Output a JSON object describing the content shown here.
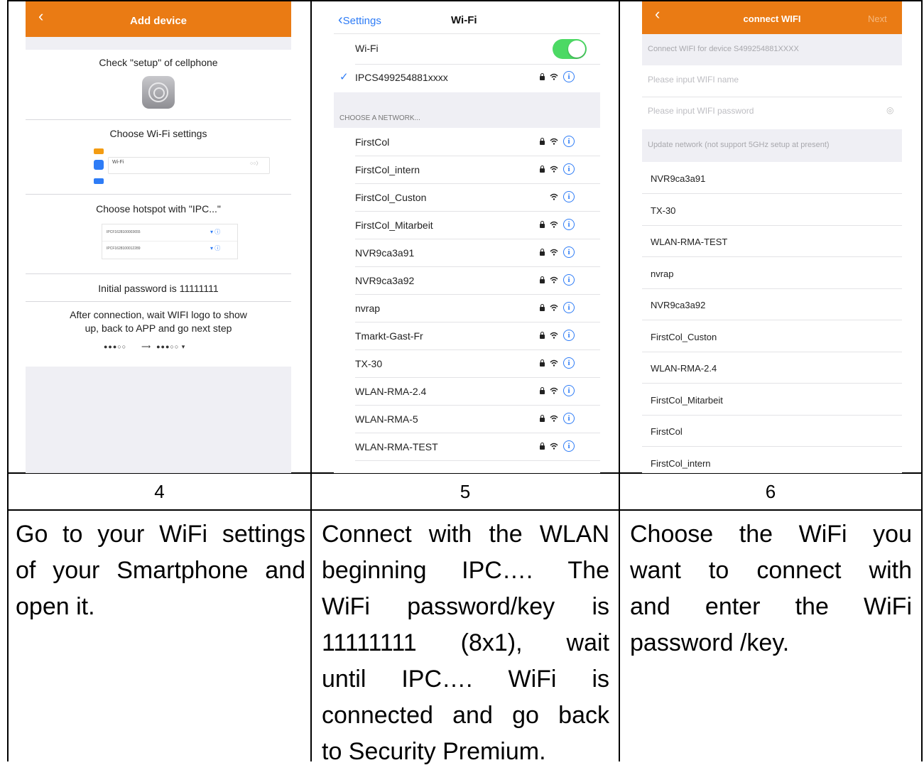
{
  "screen4": {
    "title": "Add device",
    "step1": "Check \"setup\" of cellphone",
    "step2": "Choose Wi-Fi settings",
    "mini_wifi_label": "Wi-Fi",
    "step3": "Choose hotspot with \"IPC...\"",
    "mini_hotspots": [
      "IPCF1628100003655",
      "IPCF1628100012289"
    ],
    "step4": "Initial password is 11111111",
    "step5_line1": "After connection, wait WIFI logo to show",
    "step5_line2": "up, back to APP and go next step"
  },
  "screen5": {
    "back_label": "Settings",
    "title": "Wi-Fi",
    "wifi_label": "Wi-Fi",
    "wifi_on": true,
    "connected_network": "IPCS499254881xxxx",
    "section_header": "CHOOSE A NETWORK...",
    "networks": [
      {
        "name": "FirstCol",
        "locked": true
      },
      {
        "name": "FirstCol_intern",
        "locked": true
      },
      {
        "name": "FirstCol_Custon",
        "locked": false
      },
      {
        "name": "FirstCol_Mitarbeit",
        "locked": true
      },
      {
        "name": "NVR9ca3a91",
        "locked": true
      },
      {
        "name": "NVR9ca3a92",
        "locked": true
      },
      {
        "name": "nvrap",
        "locked": true
      },
      {
        "name": "Tmarkt-Gast-Fr",
        "locked": true
      },
      {
        "name": "TX-30",
        "locked": true
      },
      {
        "name": "WLAN-RMA-2.4",
        "locked": true
      },
      {
        "name": "WLAN-RMA-5",
        "locked": true
      },
      {
        "name": "WLAN-RMA-TEST",
        "locked": true
      }
    ]
  },
  "screen6": {
    "title": "connect WIFI",
    "next_label": "Next",
    "device_note": "Connect WIFI for device S499254881XXXX",
    "name_placeholder": "Please input WIFI name",
    "password_placeholder": "Please input WIFI password",
    "update_note": "Update network (not support 5GHz setup at present)",
    "networks": [
      "NVR9ca3a91",
      "TX-30",
      "WLAN-RMA-TEST",
      "nvrap",
      "NVR9ca3a92",
      "FirstCol_Custon",
      "WLAN-RMA-2.4",
      "FirstCol_Mitarbeit",
      "FirstCol",
      "FirstCol_intern"
    ]
  },
  "steps": [
    "4",
    "5",
    "6"
  ],
  "captions": {
    "c4": [
      "Go to your WiFi settings",
      "of your Smartphone and",
      "open it."
    ],
    "c5": [
      "Connect with the WLAN",
      "beginning IPC…. The",
      "WiFi password/key is",
      "11111111 (8x1), wait",
      "until IPC…. WiFi is",
      "connected and go back",
      "to Security Premium."
    ],
    "c6": [
      "Choose the WiFi you",
      "want to connect with",
      "and enter the WiFi",
      "password /key."
    ]
  },
  "colors": {
    "accent": "#ea7b14",
    "ios_blue": "#2e7cf6",
    "toggle_green": "#4cd964"
  }
}
